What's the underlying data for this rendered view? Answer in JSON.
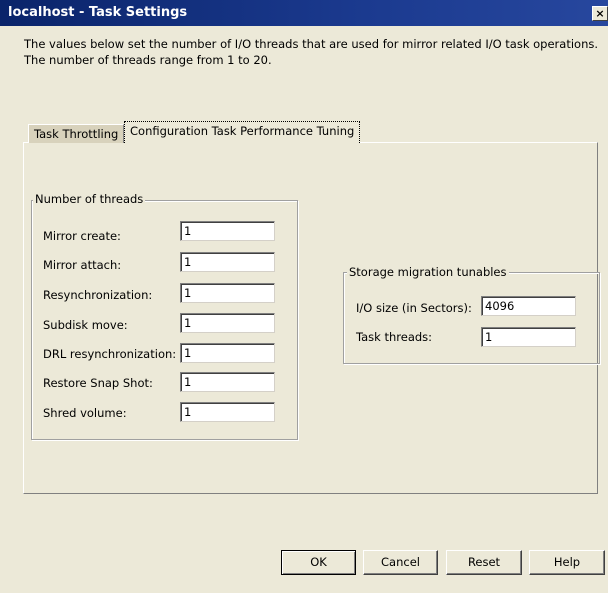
{
  "window": {
    "title": "localhost - Task Settings",
    "close_glyph": "×"
  },
  "description": {
    "line1": "The values below set the number of I/O threads that are used for mirror related I/O task operations.",
    "line2": "The number of threads range from 1 to 20."
  },
  "tabs": [
    {
      "label": "Task Throttling",
      "selected": false
    },
    {
      "label": "Configuration Task Performance Tuning",
      "selected": true
    }
  ],
  "threads_group": {
    "legend": "Number of threads",
    "rows": [
      {
        "label": "Mirror create:",
        "value": "1"
      },
      {
        "label": "Mirror attach:",
        "value": "1"
      },
      {
        "label": "Resynchronization:",
        "value": "1"
      },
      {
        "label": "Subdisk move:",
        "value": "1"
      },
      {
        "label": "DRL resynchronization:",
        "value": "1"
      },
      {
        "label": "Restore Snap Shot:",
        "value": "1"
      },
      {
        "label": "Shred volume:",
        "value": "1"
      }
    ]
  },
  "storage_group": {
    "legend": "Storage migration tunables",
    "rows": [
      {
        "label": "I/O size (in Sectors):",
        "value": "4096"
      },
      {
        "label": "Task threads:",
        "value": "1"
      }
    ]
  },
  "buttons": {
    "ok": "OK",
    "cancel": "Cancel",
    "reset": "Reset",
    "help": "Help"
  },
  "colors": {
    "titlebar": "#0a246a",
    "dialog_bg": "#ece9d8"
  }
}
